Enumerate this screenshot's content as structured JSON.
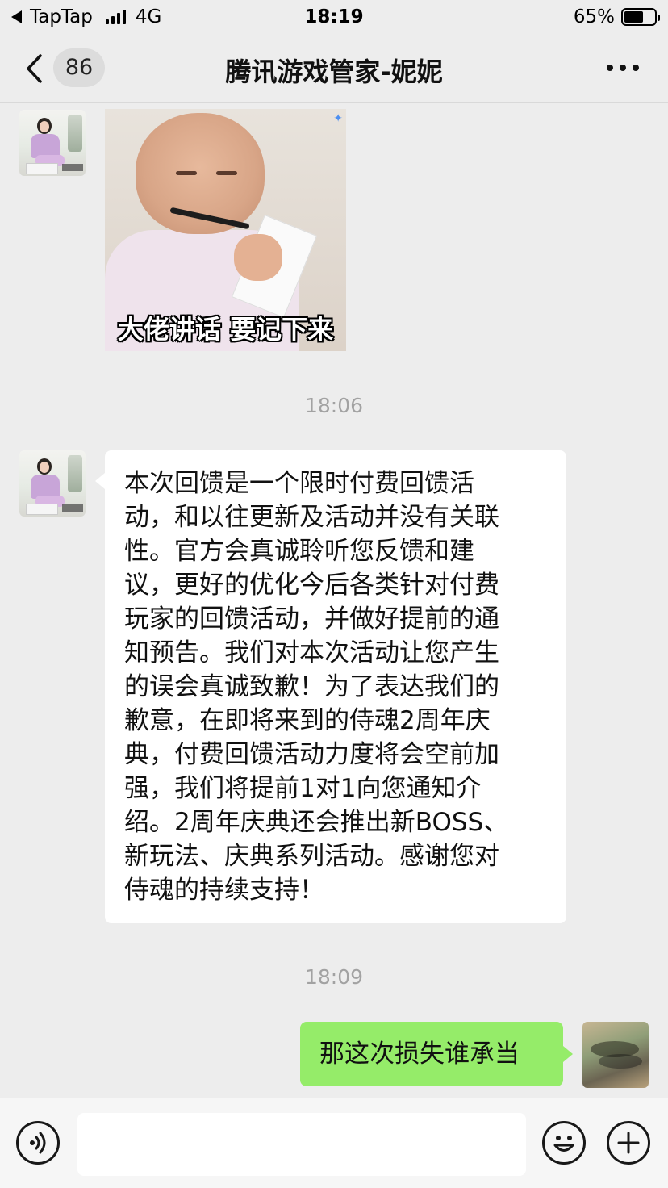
{
  "status_bar": {
    "carrier": "TapTap",
    "network": "4G",
    "time": "18:19",
    "battery": "65%",
    "battery_level": 0.65
  },
  "header": {
    "back_badge": "86",
    "title": "腾讯游戏管家-妮妮"
  },
  "messages": [
    {
      "type": "image",
      "from": "other",
      "caption": "大佬讲话 要记下来"
    },
    {
      "type": "timestamp",
      "text": "18:06"
    },
    {
      "type": "text",
      "from": "other",
      "text": "本次回馈是一个限时付费回馈活\n动，和以往更新及活动并没有关联\n性。官方会真诚聆听您反馈和建\n议，更好的优化今后各类针对付费\n玩家的回馈活动，并做好提前的通\n知预告。我们对本次活动让您产生\n的误会真诚致歉！为了表达我们的\n歉意，在即将来到的侍魂2周年庆\n典，付费回馈活动力度将会空前加\n强，我们将提前1对1向您通知介\n绍。2周年庆典还会推出新BOSS、\n新玩法、庆典系列活动。感谢您对\n侍魂的持续支持！"
    },
    {
      "type": "timestamp",
      "text": "18:09"
    },
    {
      "type": "text",
      "from": "me",
      "text": "那这次损失谁承当"
    }
  ],
  "input_bar": {
    "voice_icon": "voice-icon",
    "emoji_icon": "emoji-icon",
    "plus_icon": "plus-icon",
    "input_value": ""
  },
  "colors": {
    "background": "#ededed",
    "bubble_incoming": "#ffffff",
    "bubble_outgoing": "#95ec69",
    "timestamp_text": "#a2a2a2"
  }
}
